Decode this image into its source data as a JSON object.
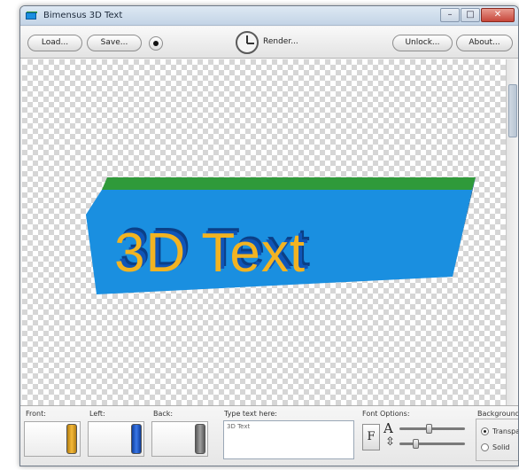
{
  "window": {
    "title": "Bimensus 3D Text",
    "controls": {
      "minimize": "–",
      "maximize": "□",
      "close": "✕"
    }
  },
  "toolbar": {
    "load_label": "Load...",
    "save_label": "Save...",
    "render_label": "Render...",
    "unlock_label": "Unlock...",
    "about_label": "About..."
  },
  "canvas": {
    "text": "3D Text",
    "colors": {
      "front": "#f2b321",
      "face": "#1a8fe0",
      "side": "#0f55b8",
      "top": "#2f9a3a"
    }
  },
  "bottom": {
    "front_label": "Front:",
    "left_label": "Left:",
    "back_label": "Back:",
    "text_label": "Type text here:",
    "text_value": "3D Text",
    "font_label": "Font Options:",
    "font_button": "F",
    "size_glyph": "A",
    "height_glyph": "⇳",
    "background_label": "Background:",
    "bg_option_transparent": "Transparent",
    "bg_option_solid": "Solid",
    "size_slider_value": 0.45,
    "height_slider_value": 0.22
  },
  "icons": [
    "app-icon",
    "dot-icon",
    "clock-icon"
  ]
}
